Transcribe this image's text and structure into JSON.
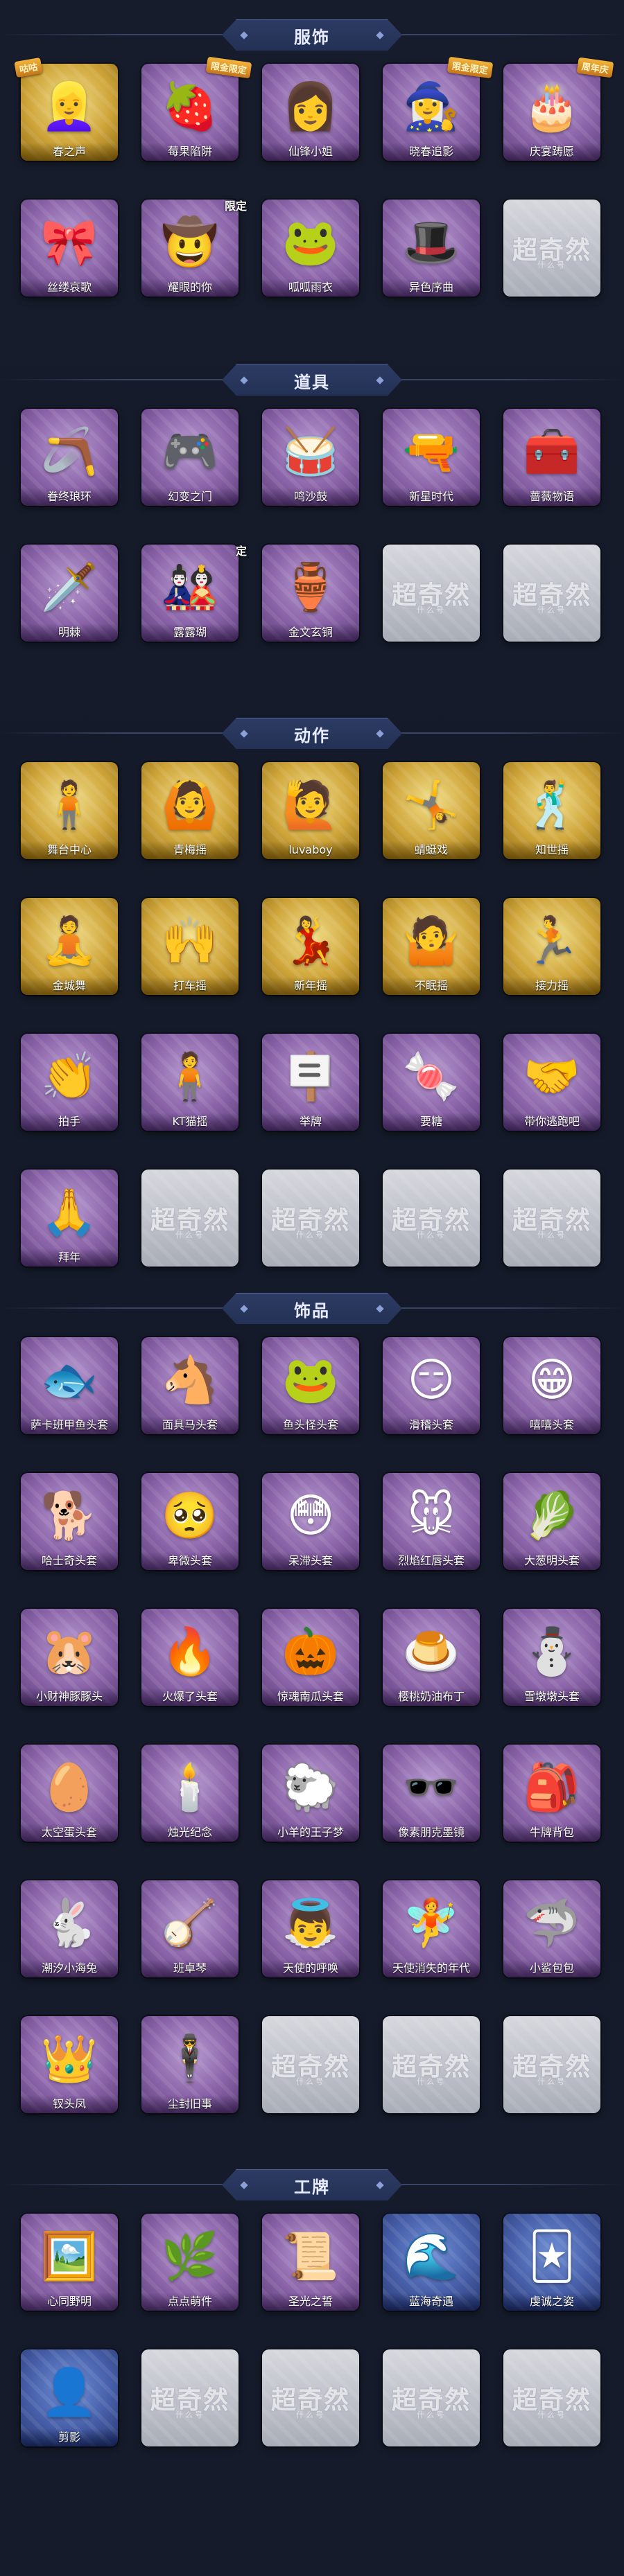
{
  "sections": [
    {
      "title": "服饰",
      "items": [
        {
          "label": "春之声",
          "icon": "👱‍♀️",
          "style": "gold",
          "tag": "咕咕",
          "tag_side": "left"
        },
        {
          "label": "莓果陷阱",
          "icon": "🍓",
          "style": "purple",
          "tag": "限金限定"
        },
        {
          "label": "仙锋小姐",
          "icon": "👩",
          "style": "purple"
        },
        {
          "label": "晓春追影",
          "icon": "🧙‍♀️",
          "style": "purple",
          "tag": "限金限定"
        },
        {
          "label": "庆宴踌愿",
          "icon": "🎂",
          "style": "purple",
          "tag": "周年庆"
        },
        {
          "label": "丝缕哀歌",
          "icon": "🎀",
          "style": "purple"
        },
        {
          "label": "耀眼的你",
          "icon": "🤠",
          "style": "purple",
          "tag": "限定",
          "tag_plain": true
        },
        {
          "label": "呱呱雨衣",
          "icon": "🐸",
          "style": "purple"
        },
        {
          "label": "异色序曲",
          "icon": "🎩",
          "style": "purple"
        },
        {
          "label": "",
          "icon": "",
          "style": "empty"
        }
      ]
    },
    {
      "title": "道具",
      "items": [
        {
          "label": "眷终琅环",
          "icon": "🪃",
          "style": "purple"
        },
        {
          "label": "幻变之门",
          "icon": "🎮",
          "style": "purple"
        },
        {
          "label": "鸣沙鼓",
          "icon": "🥁",
          "style": "purple"
        },
        {
          "label": "新星时代",
          "icon": "🔫",
          "style": "purple"
        },
        {
          "label": "蔷薇物语",
          "icon": "🧰",
          "style": "purple"
        },
        {
          "label": "明棘",
          "icon": "🗡️",
          "style": "purple"
        },
        {
          "label": "露露瑚",
          "icon": "🎎",
          "style": "purple",
          "tag": "定",
          "tag_plain": true
        },
        {
          "label": "金文玄铜",
          "icon": "🏺",
          "style": "purple"
        },
        {
          "label": "",
          "icon": "",
          "style": "empty"
        },
        {
          "label": "",
          "icon": "",
          "style": "empty"
        }
      ]
    },
    {
      "title": "动作",
      "items": [
        {
          "label": "舞台中心",
          "icon": "🧍",
          "style": "gold"
        },
        {
          "label": "青梅摇",
          "icon": "🙆",
          "style": "gold"
        },
        {
          "label": "luvaboy",
          "icon": "🙋",
          "style": "gold"
        },
        {
          "label": "蜻蜓戏",
          "icon": "🤸",
          "style": "gold"
        },
        {
          "label": "知世摇",
          "icon": "🕺",
          "style": "gold"
        },
        {
          "label": "金城舞",
          "icon": "🧘",
          "style": "gold"
        },
        {
          "label": "打车摇",
          "icon": "🙌",
          "style": "gold"
        },
        {
          "label": "新年摇",
          "icon": "💃",
          "style": "gold"
        },
        {
          "label": "不眠摇",
          "icon": "🤷",
          "style": "gold"
        },
        {
          "label": "接力摇",
          "icon": "🏃",
          "style": "gold"
        },
        {
          "label": "拍手",
          "icon": "👏",
          "style": "purple"
        },
        {
          "label": "KT猫摇",
          "icon": "🧍",
          "style": "purple"
        },
        {
          "label": "举牌",
          "icon": "🪧",
          "style": "purple"
        },
        {
          "label": "要糖",
          "icon": "🍬",
          "style": "purple"
        },
        {
          "label": "带你逃跑吧",
          "icon": "🤝",
          "style": "purple"
        },
        {
          "label": "拜年",
          "icon": "🙏",
          "style": "purple"
        },
        {
          "label": "",
          "icon": "",
          "style": "empty"
        },
        {
          "label": "",
          "icon": "",
          "style": "empty"
        },
        {
          "label": "",
          "icon": "",
          "style": "empty"
        },
        {
          "label": "",
          "icon": "",
          "style": "empty"
        }
      ]
    },
    {
      "title": "饰品",
      "items": [
        {
          "label": "萨卡班甲鱼头套",
          "icon": "🐟",
          "style": "purple"
        },
        {
          "label": "面具马头套",
          "icon": "🐴",
          "style": "purple"
        },
        {
          "label": "鱼头怪头套",
          "icon": "🐸",
          "style": "purple"
        },
        {
          "label": "滑稽头套",
          "icon": "😏",
          "style": "purple"
        },
        {
          "label": "嘻嘻头套",
          "icon": "😁",
          "style": "purple"
        },
        {
          "label": "哈士奇头套",
          "icon": "🐕",
          "style": "purple"
        },
        {
          "label": "卑微头套",
          "icon": "🥺",
          "style": "purple"
        },
        {
          "label": "呆滞头套",
          "icon": "😳",
          "style": "purple"
        },
        {
          "label": "烈焰红唇头套",
          "icon": "🐭",
          "style": "purple"
        },
        {
          "label": "大葱明头套",
          "icon": "🥬",
          "style": "purple"
        },
        {
          "label": "小财神豚豚头",
          "icon": "🐹",
          "style": "purple"
        },
        {
          "label": "火爆了头套",
          "icon": "🔥",
          "style": "purple"
        },
        {
          "label": "惊魂南瓜头套",
          "icon": "🎃",
          "style": "purple"
        },
        {
          "label": "樱桃奶油布丁",
          "icon": "🍮",
          "style": "purple"
        },
        {
          "label": "雪墩墩头套",
          "icon": "⛄",
          "style": "purple"
        },
        {
          "label": "太空蛋头套",
          "icon": "🥚",
          "style": "purple"
        },
        {
          "label": "烛光纪念",
          "icon": "🕯️",
          "style": "purple"
        },
        {
          "label": "小羊的王子梦",
          "icon": "🐑",
          "style": "purple"
        },
        {
          "label": "像素朋克墨镜",
          "icon": "🕶️",
          "style": "purple"
        },
        {
          "label": "牛牌背包",
          "icon": "🎒",
          "style": "purple"
        },
        {
          "label": "潮汐小海兔",
          "icon": "🐇",
          "style": "purple"
        },
        {
          "label": "班卓琴",
          "icon": "🪕",
          "style": "purple"
        },
        {
          "label": "天使的呼唤",
          "icon": "👼",
          "style": "purple"
        },
        {
          "label": "天使消失的年代",
          "icon": "🧚",
          "style": "purple"
        },
        {
          "label": "小鲨包包",
          "icon": "🦈",
          "style": "purple"
        },
        {
          "label": "钗头凤",
          "icon": "👑",
          "style": "purple"
        },
        {
          "label": "尘封旧事",
          "icon": "🕴️",
          "style": "purple"
        },
        {
          "label": "",
          "icon": "",
          "style": "empty"
        },
        {
          "label": "",
          "icon": "",
          "style": "empty"
        },
        {
          "label": "",
          "icon": "",
          "style": "empty"
        }
      ]
    },
    {
      "title": "工牌",
      "items": [
        {
          "label": "心同野明",
          "icon": "🖼️",
          "style": "purple"
        },
        {
          "label": "点点萌件",
          "icon": "🌿",
          "style": "purple"
        },
        {
          "label": "圣光之誓",
          "icon": "📜",
          "style": "purple"
        },
        {
          "label": "蓝海奇遇",
          "icon": "🌊",
          "style": "blue"
        },
        {
          "label": "虔诚之姿",
          "icon": "🃏",
          "style": "blue"
        },
        {
          "label": "剪影",
          "icon": "👤",
          "style": "blue"
        },
        {
          "label": "",
          "icon": "",
          "style": "empty"
        },
        {
          "label": "",
          "icon": "",
          "style": "empty"
        },
        {
          "label": "",
          "icon": "",
          "style": "empty"
        },
        {
          "label": "",
          "icon": "",
          "style": "empty"
        }
      ]
    }
  ],
  "empty_placeholder": {
    "mark": "超奇然",
    "sub": "什么号"
  }
}
